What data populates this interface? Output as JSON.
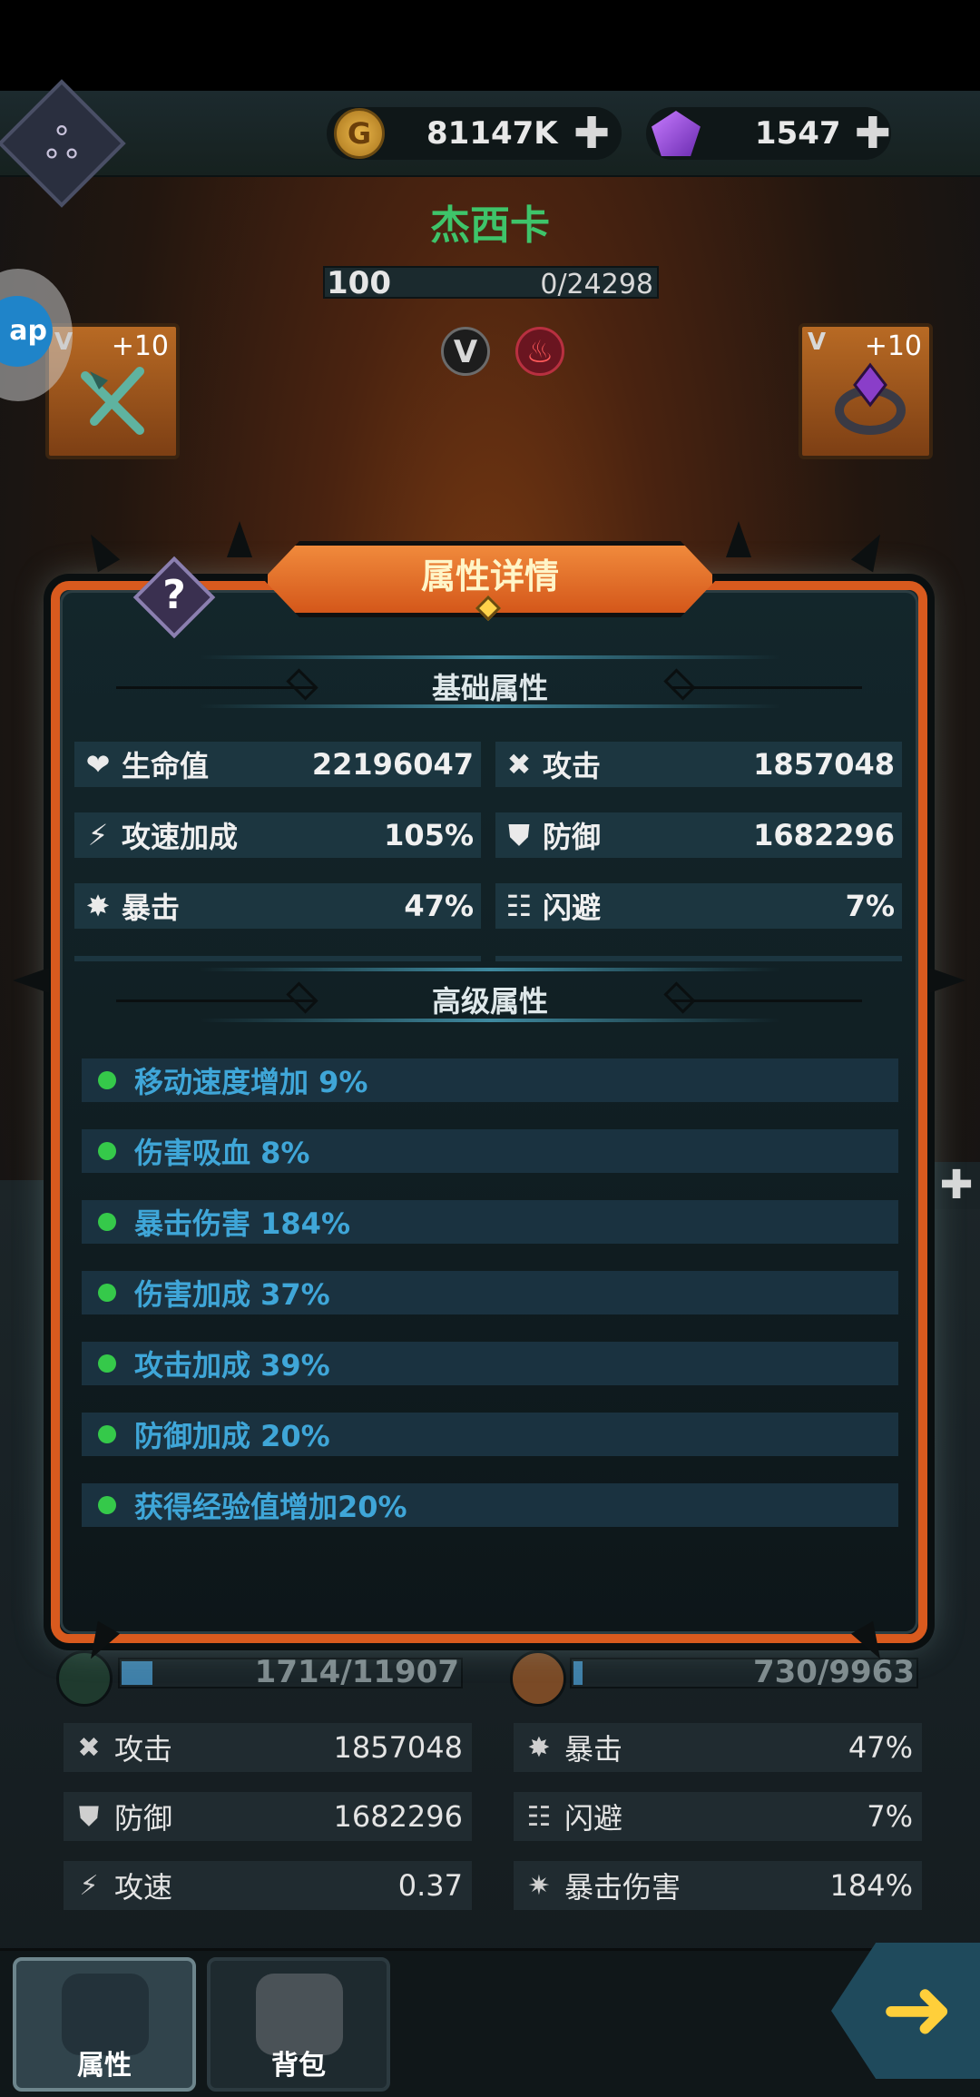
{
  "topbar": {
    "gold_value": "81147K",
    "gold_icon": "gold-coin-icon",
    "gem_value": "1547",
    "gem_icon": "purple-gem-icon",
    "plus_label": "✚"
  },
  "hero": {
    "name": "杰西卡",
    "level": "100",
    "exp": "0/24298",
    "badge_v": "V",
    "badge_fire": "🔥",
    "left_item_plus": "+10",
    "right_item_plus": "+10",
    "item_v": "V"
  },
  "ap_label": "ap",
  "modal": {
    "title": "属性详情",
    "help_glyph": "?",
    "basic_header": "基础属性",
    "advanced_header": "高级属性",
    "basic_stats": [
      {
        "icon": "heart-icon",
        "glyph": "❤",
        "label": "生命值",
        "value": "22196047"
      },
      {
        "icon": "attack-icon",
        "glyph": "✖",
        "label": "攻击",
        "value": "1857048"
      },
      {
        "icon": "attack-speed-icon",
        "glyph": "⚡",
        "label": "攻速加成",
        "value": "105%"
      },
      {
        "icon": "shield-icon",
        "glyph": "⛊",
        "label": "防御",
        "value": "1682296"
      },
      {
        "icon": "crit-icon",
        "glyph": "✸",
        "label": "暴击",
        "value": "47%"
      },
      {
        "icon": "dodge-icon",
        "glyph": "☷",
        "label": "闪避",
        "value": "7%"
      }
    ],
    "advanced_stats": [
      "移动速度增加 9%",
      "伤害吸血 8%",
      "暴击伤害 184%",
      "伤害加成 37%",
      "攻击加成 39%",
      "防御加成 20%",
      "获得经验值增加20%"
    ],
    "accent_color": "#d85a1e",
    "advanced_text_color": "#3fa6d8"
  },
  "lower": {
    "res_left": "1714/11907",
    "res_right": "730/9963",
    "stats": [
      {
        "icon": "attack-icon",
        "glyph": "✖",
        "label": "攻击",
        "value": "1857048"
      },
      {
        "icon": "crit-icon",
        "glyph": "✸",
        "label": "暴击",
        "value": "47%"
      },
      {
        "icon": "shield-icon",
        "glyph": "⛊",
        "label": "防御",
        "value": "1682296"
      },
      {
        "icon": "dodge-icon",
        "glyph": "☷",
        "label": "闪避",
        "value": "7%"
      },
      {
        "icon": "attack-speed-icon",
        "glyph": "⚡",
        "label": "攻速",
        "value": "0.37"
      },
      {
        "icon": "crit-damage-icon",
        "glyph": "✷",
        "label": "暴击伤害",
        "value": "184%"
      }
    ]
  },
  "tabs": {
    "attributes": "属性",
    "backpack": "背包"
  },
  "side_plus": "✚",
  "next_arrow": "➜"
}
